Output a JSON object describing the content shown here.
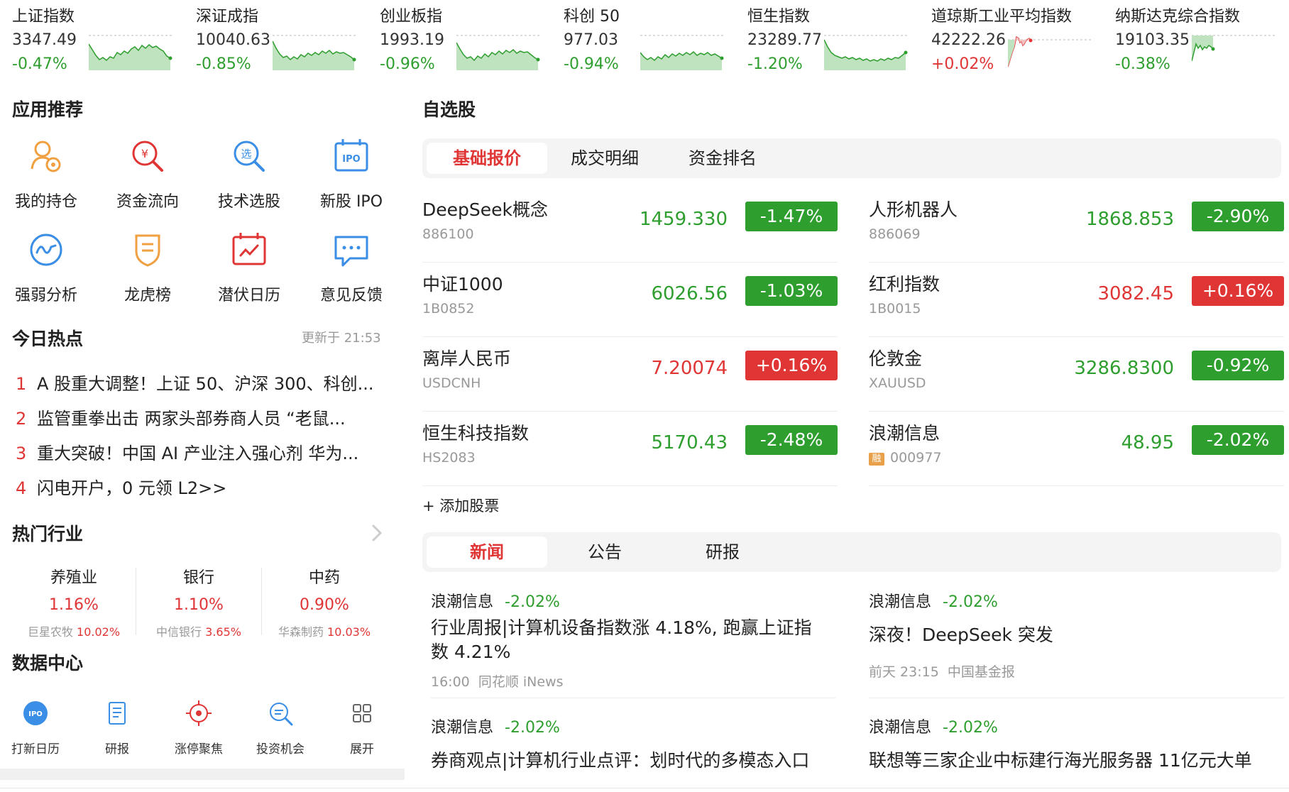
{
  "indices": [
    {
      "name": "上证指数",
      "value": "3347.49",
      "change": "-0.47%",
      "trend": "down"
    },
    {
      "name": "深证成指",
      "value": "10040.63",
      "change": "-0.85%",
      "trend": "down"
    },
    {
      "name": "创业板指",
      "value": "1993.19",
      "change": "-0.96%",
      "trend": "down"
    },
    {
      "name": "科创 50",
      "value": "977.03",
      "change": "-0.94%",
      "trend": "down"
    },
    {
      "name": "恒生指数",
      "value": "23289.77",
      "change": "-1.20%",
      "trend": "down"
    },
    {
      "name": "道琼斯工业平均指数",
      "value": "42222.26",
      "change": "+0.02%",
      "trend": "up"
    },
    {
      "name": "纳斯达克综合指数",
      "value": "19103.35",
      "change": "-0.38%",
      "trend": "down"
    }
  ],
  "apps": {
    "title": "应用推荐",
    "items": [
      {
        "label": "我的持仓",
        "icon": "position-icon"
      },
      {
        "label": "资金流向",
        "icon": "fund-flow-icon"
      },
      {
        "label": "技术选股",
        "icon": "stock-picker-icon"
      },
      {
        "label": "新股 IPO",
        "icon": "ipo-icon"
      },
      {
        "label": "强弱分析",
        "icon": "strength-analysis-icon"
      },
      {
        "label": "龙虎榜",
        "icon": "dragon-tiger-icon"
      },
      {
        "label": "潜伏日历",
        "icon": "calendar-icon"
      },
      {
        "label": "意见反馈",
        "icon": "feedback-icon"
      }
    ]
  },
  "hot": {
    "title": "今日热点",
    "updated": "更新于 21:53",
    "items": [
      {
        "rank": "1",
        "text": "A 股重大调整！上证 50、沪深 300、科创..."
      },
      {
        "rank": "2",
        "text": "监管重拳出击 两家头部券商人员 “老鼠..."
      },
      {
        "rank": "3",
        "text": "重大突破！中国 AI 产业注入强心剂 华为..."
      },
      {
        "rank": "4",
        "text": "闪电开户，0 元领 L2>>"
      }
    ]
  },
  "industries": {
    "title": "热门行业",
    "items": [
      {
        "name": "养殖业",
        "change": "1.16%",
        "leader": "巨星农牧",
        "leader_change": "10.02%"
      },
      {
        "name": "银行",
        "change": "1.10%",
        "leader": "中信银行",
        "leader_change": "3.65%"
      },
      {
        "name": "中药",
        "change": "0.90%",
        "leader": "华森制药",
        "leader_change": "10.03%"
      }
    ]
  },
  "data_center": {
    "title": "数据中心",
    "items": [
      {
        "label": "打新日历",
        "icon": "ipo-calendar-icon"
      },
      {
        "label": "研报",
        "icon": "report-icon"
      },
      {
        "label": "涨停聚焦",
        "icon": "limit-up-icon"
      },
      {
        "label": "投资机会",
        "icon": "opportunity-icon"
      },
      {
        "label": "展开",
        "icon": "grid-icon"
      }
    ]
  },
  "watchlist": {
    "title": "自选股",
    "tabs": [
      "基础报价",
      "成交明细",
      "资金排名"
    ],
    "add_label": "+ 添加股票",
    "stocks": [
      {
        "name": "DeepSeek概念",
        "code": "886100",
        "price": "1459.330",
        "change": "-1.47%",
        "dir": "down",
        "margin": false
      },
      {
        "name": "人形机器人",
        "code": "886069",
        "price": "1868.853",
        "change": "-2.90%",
        "dir": "down",
        "margin": false
      },
      {
        "name": "中证1000",
        "code": "1B0852",
        "price": "6026.56",
        "change": "-1.03%",
        "dir": "down",
        "margin": false
      },
      {
        "name": "红利指数",
        "code": "1B0015",
        "price": "3082.45",
        "change": "+0.16%",
        "dir": "up",
        "margin": false
      },
      {
        "name": "离岸人民币",
        "code": "USDCNH",
        "price": "7.20074",
        "change": "+0.16%",
        "dir": "up",
        "margin": false
      },
      {
        "name": "伦敦金",
        "code": "XAUUSD",
        "price": "3286.8300",
        "change": "-0.92%",
        "dir": "down",
        "margin": false
      },
      {
        "name": "恒生科技指数",
        "code": "HS2083",
        "price": "5170.43",
        "change": "-2.48%",
        "dir": "down",
        "margin": false
      },
      {
        "name": "浪潮信息",
        "code": "000977",
        "price": "48.95",
        "change": "-2.02%",
        "dir": "down",
        "margin": true,
        "margin_label": "融"
      }
    ]
  },
  "news": {
    "tabs": [
      "新闻",
      "公告",
      "研报"
    ],
    "items": [
      {
        "stock": "浪潮信息",
        "change": "-2.02%",
        "title": "行业周报|计算机设备指数涨 4.18%, 跑赢上证指数 4.21%",
        "time": "16:00",
        "source": "同花顺 iNews"
      },
      {
        "stock": "浪潮信息",
        "change": "-2.02%",
        "title": "深夜！DeepSeek 突发",
        "time": "前天 23:15",
        "source": "中国基金报"
      },
      {
        "stock": "浪潮信息",
        "change": "-2.02%",
        "title": "券商观点|计算机行业点评：划时代的多模态入口",
        "time": "",
        "source": ""
      },
      {
        "stock": "浪潮信息",
        "change": "-2.02%",
        "title": "联想等三家企业中标建行海光服务器 11亿元大单",
        "time": "",
        "source": ""
      }
    ]
  },
  "colors": {
    "up": "#e03535",
    "down": "#2e9e2e",
    "accent": "#e03535",
    "icon_blue": "#3a8ee6",
    "icon_orange": "#f0a040"
  }
}
